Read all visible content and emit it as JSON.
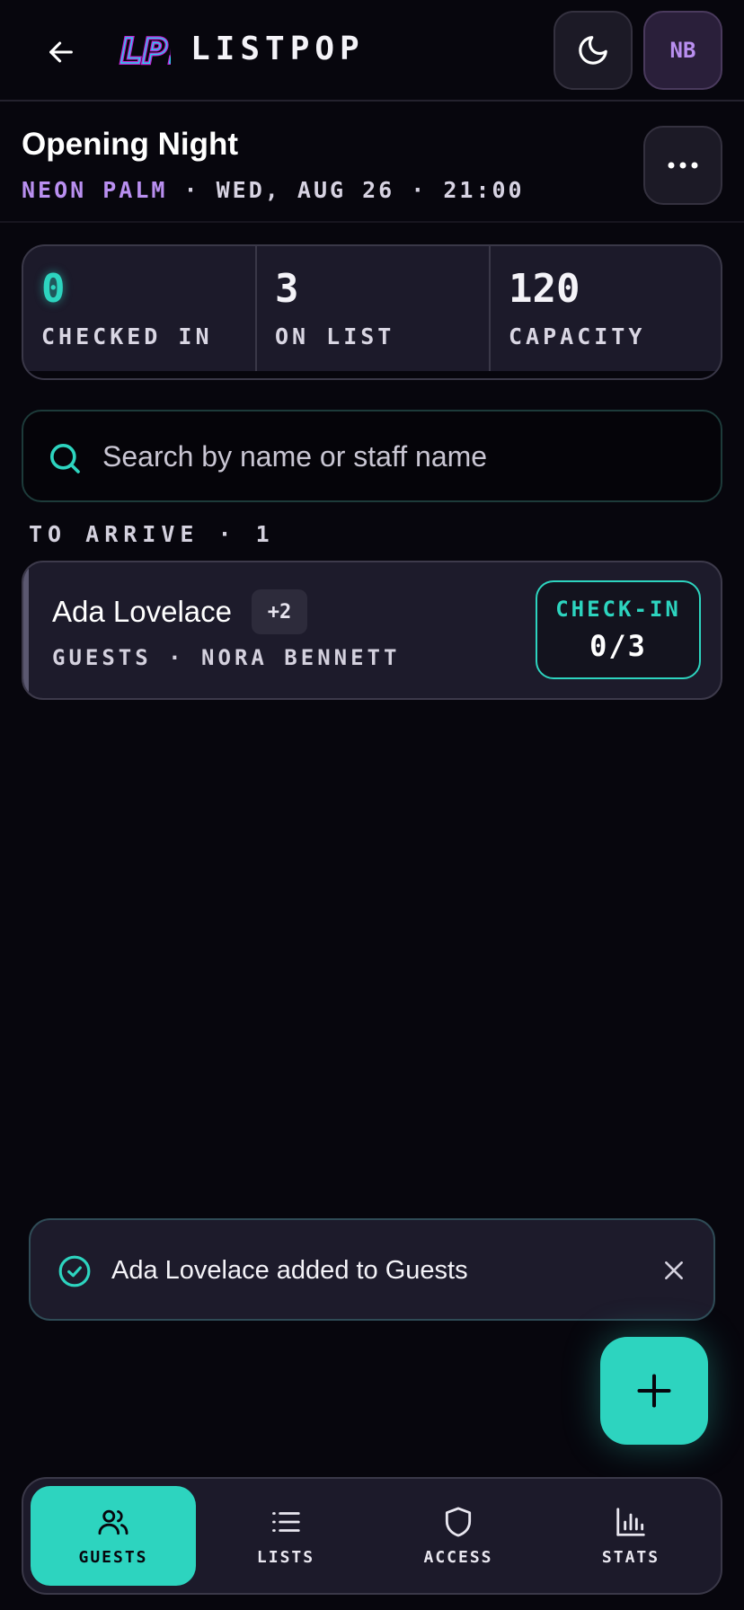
{
  "header": {
    "brand": "LISTPOP",
    "logo_text": "LP!",
    "avatar_initials": "NB"
  },
  "event": {
    "title": "Opening Night",
    "venue": "NEON PALM",
    "datetime": "· WED, AUG 26 · 21:00"
  },
  "stats": {
    "checked_in": {
      "value": "0",
      "label": "CHECKED IN"
    },
    "on_list": {
      "value": "3",
      "label": "ON LIST"
    },
    "capacity": {
      "value": "120",
      "label": "CAPACITY"
    },
    "progress_fraction": 0
  },
  "search": {
    "placeholder": "Search by name or staff name",
    "value": ""
  },
  "section": {
    "label": "TO ARRIVE · 1"
  },
  "guests": [
    {
      "name": "Ada Lovelace",
      "plus": "+2",
      "meta": "GUESTS · NORA BENNETT",
      "checkin_label": "CHECK-IN",
      "checkin_count": "0/3"
    }
  ],
  "toast": {
    "message": "Ada Lovelace added to Guests"
  },
  "nav": [
    {
      "label": "GUESTS",
      "icon": "users-icon",
      "active": true
    },
    {
      "label": "LISTS",
      "icon": "list-icon",
      "active": false
    },
    {
      "label": "ACCESS",
      "icon": "shield-icon",
      "active": false
    },
    {
      "label": "STATS",
      "icon": "bar-chart-icon",
      "active": false
    }
  ],
  "colors": {
    "background": "#07060d",
    "accent": "#2dd4bf",
    "purple": "#b98ff0",
    "surface": "#1c1a2a"
  }
}
